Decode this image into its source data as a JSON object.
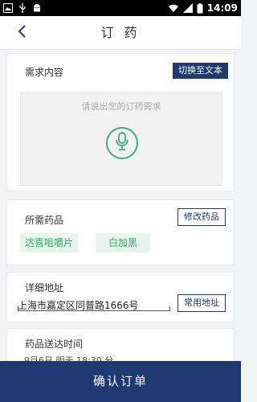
{
  "statusbar": {
    "time": "14:09",
    "icons_left": [
      "image-icon",
      "usb-icon",
      "android-icon"
    ],
    "icons_right": [
      "wifi-icon",
      "signal-icon",
      "battery-icon"
    ]
  },
  "header": {
    "title": "订 药",
    "back_icon": "chevron-left-icon"
  },
  "request": {
    "title": "需求内容",
    "switch_label": "切换至文本",
    "hint": "请说出您的订药需求",
    "mic_icon": "microphone-icon"
  },
  "medicines": {
    "title": "所需药品",
    "edit_label": "修改药品",
    "items": [
      "达喜咀嚼片",
      "白加黑"
    ]
  },
  "address": {
    "title": "详细地址",
    "value": "上海市嘉定区同普路1666号",
    "common_label": "常用地址"
  },
  "delivery": {
    "title": "药品送达时间",
    "value": "9月6日 明天 18:30 分"
  },
  "confirm": {
    "label": "确认订单"
  },
  "colors": {
    "primary": "#1f3a72",
    "accent_green": "#3bb273",
    "tag_bg": "#e7f5ec",
    "page_bg": "#f1f3f4"
  }
}
